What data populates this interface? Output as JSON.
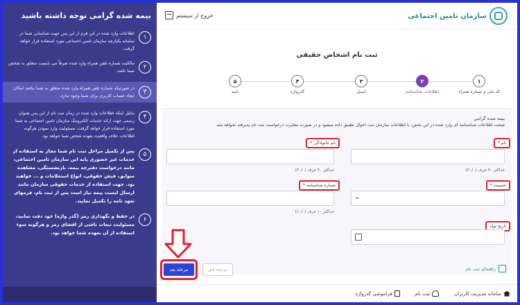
{
  "sidebar": {
    "title": "بیمه شده گرامی توجه داشته باشید",
    "notes": [
      {
        "num": "۱",
        "text": "اطلاعات وارد شده در این فرم از این پس جهت شناسایی شما در سامانه یکپارچه سازمان تامین اجتماعی مورد استفاده قرار خواهد گرفت."
      },
      {
        "num": "۲",
        "text": "مالکیت شماره تلفن همراه وارد شده صرفاً می بایست متعلق به شخص شما باشد."
      },
      {
        "num": "۳",
        "text": "در صورتیکه شماره تلفن همراه وارد شده متعلق به شما نباشد امکان ایجاد حساب کاربری برای شما وجود ندارد."
      },
      {
        "num": "۴",
        "text": "بدلیل اینکه اطلاعات وارد شده در زمان ثبت نام از این پس بعنوان رسمی جهت ارائه خدمات الکترونیک سازمان تامین اجتماعی به شما مورد استفاده قرار خواهد گرفت، مسئولیت وارد نمودن هرگونه اطلاعات خلاف واقعیت بعهده شخص شما خواهد بود."
      },
      {
        "num": "۵",
        "text": "پس از تکمیل مراحل ثبت نام شما مجاز به استفاده از خدمات غیر حضوری پایه این سازمان تامین اجتماعی، مانند درخواست دفترچه بیمه، بازنشستگی، مشاهده سوابق، فیش حقوقی، انواع استعلامات و ... خواهید بود. جهت استفاده از خدمات حقوقی سازمان مانند ارسال لیست بیمه نیاز است پس از ثبت نام، فرمهای تعهد نامه را تکمیل نمایید."
      },
      {
        "num": "۶",
        "text": "در حفظ و نگهداری رمز (گذر واژه) خود دقت نمایید، مسئولیت تبعات ناشی از افشای رمز و هرگونه سوء استفاده از آن بعهده شما خواهد بود."
      }
    ]
  },
  "topbar": {
    "org_name": "سازمان تامین اجتماعی",
    "logout_label": "خروج از سیستم"
  },
  "page_title": "ثبت نام اشخاص حقیقی",
  "steps": [
    {
      "num": "۱",
      "label": "کد ملی و شماره همراه"
    },
    {
      "num": "۲",
      "label": "اطلاعات شناسنامه"
    },
    {
      "num": "۳",
      "label": "ایمیل"
    },
    {
      "num": "۴",
      "label": "گذرواژه"
    },
    {
      "num": "۵",
      "label": "تایید"
    }
  ],
  "form": {
    "note_title": "بیمه شده گرامی",
    "note_text": "صحت اطلاعات شناسنامه ای وارد شده در این بخش، با اطلاعات سازمان ثبت احوال تطبیق داده میشود و در صورت مغایرت درخواست ثبت نام پذیرفته نخواهد شد.",
    "first_name_label": "نام *",
    "last_name_label": "نام خانوادگی *",
    "first_name_hint": "حداکثر ۳۰ حرف (۳۰/۰)",
    "last_name_hint": "حداکثر ۳۰ حرف (۳۰/۰)",
    "gender_label": "جنسیت *",
    "id_number_label": "شماره شناسنامه *",
    "id_number_hint": "حداکثر ۱۰ حرف (۱۰/۰)",
    "birth_date_label": "تاریخ تولد"
  },
  "actions": {
    "guide_label": "راهنمای ثبت نام",
    "prev_label": "مرحله قبل",
    "next_label": "مرحله بعد"
  },
  "footer": {
    "items": [
      {
        "label": "سامانه مدیریت کاربران"
      },
      {
        "label": "ثبت نام"
      },
      {
        "label": "فراموشی گذرواژه"
      }
    ]
  },
  "colors": {
    "sidebar_bg": "#3b3b8c",
    "accent": "#7a3fb4",
    "primary_button": "#2f43d6",
    "highlight_red": "#e0202a",
    "frame_blue": "#2a2fd6",
    "brand_teal": "#2a8c86"
  }
}
